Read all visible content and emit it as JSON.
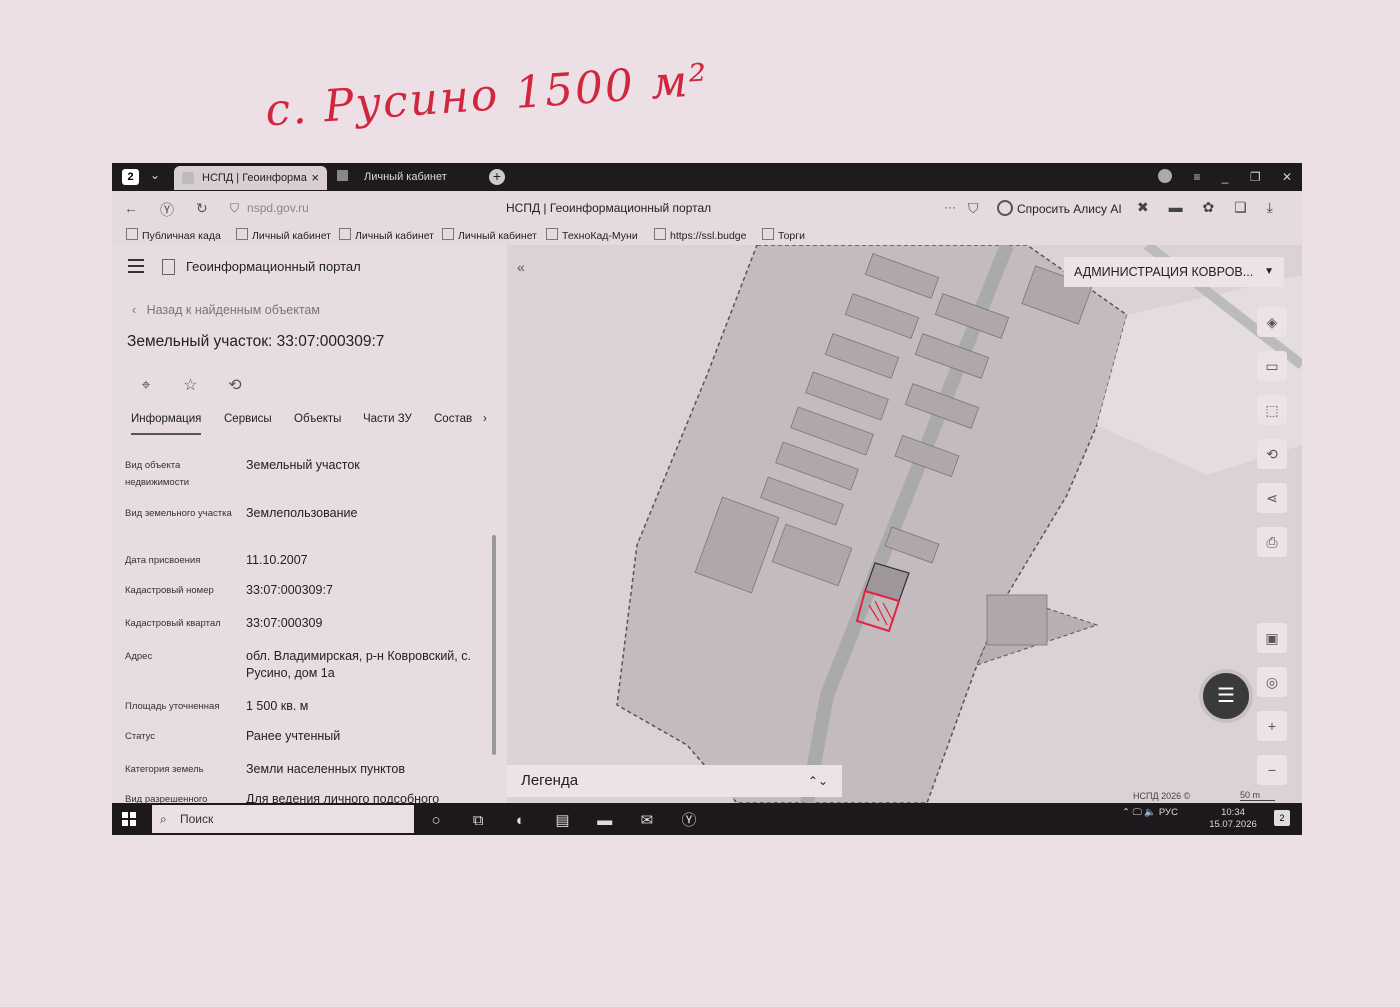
{
  "note": {
    "handwriting": "с. Русино 1500 м²"
  },
  "browser": {
    "tab_counter": "2",
    "tabs": [
      {
        "label": "НСПД | Геоинформац"
      },
      {
        "label": "Личный кабинет"
      }
    ],
    "url": "nspd.gov.ru",
    "page_title": "НСПД | Геоинформационный портал",
    "alice_label": "Спросить Алису AI",
    "bookmarks": [
      {
        "label": "Публичная када"
      },
      {
        "label": "Личный кабинет"
      },
      {
        "label": "Личный кабинет"
      },
      {
        "label": "Личный кабинет"
      },
      {
        "label": "ТехноКад-Муни"
      },
      {
        "label": "https://ssl.budge"
      },
      {
        "label": "Торги"
      }
    ]
  },
  "panel": {
    "portal_title": "Геоинформационный портал",
    "back_link": "Назад к найденным объектам",
    "object_title": "Земельный участок: 33:07:000309:7",
    "tabs": [
      {
        "label": "Информация"
      },
      {
        "label": "Сервисы"
      },
      {
        "label": "Объекты"
      },
      {
        "label": "Части ЗУ"
      },
      {
        "label": "Состав"
      }
    ],
    "properties": [
      {
        "key": "Вид объекта недвижимости",
        "value": "Земельный участок"
      },
      {
        "key": "Вид земельного участка",
        "value": "Землепользование"
      },
      {
        "key": "Дата присвоения",
        "value": "11.10.2007"
      },
      {
        "key": "Кадастровый номер",
        "value": "33:07:000309:7"
      },
      {
        "key": "Кадастровый квартал",
        "value": "33:07:000309"
      },
      {
        "key": "Адрес",
        "value": "обл. Владимирская, р-н Ковровский, с. Русино, дом 1а"
      },
      {
        "key": "Площадь уточненная",
        "value": "1 500 кв. м"
      },
      {
        "key": "Статус",
        "value": "Ранее учтенный"
      },
      {
        "key": "Категория земель",
        "value": "Земли населенных пунктов"
      },
      {
        "key": "Вид разрешенного",
        "value": "Для ведения личного подсобного"
      }
    ]
  },
  "map": {
    "admin_select": "АДМИНИСТРАЦИЯ КОВРОВ...",
    "legend_label": "Легенда",
    "copyright": "НСПД 2026 ©",
    "scale": "50 m"
  },
  "taskbar": {
    "search_placeholder": "Поиск",
    "lang": "РУС",
    "time": "10:34",
    "date": "15.07.2026",
    "notifications": "2"
  }
}
